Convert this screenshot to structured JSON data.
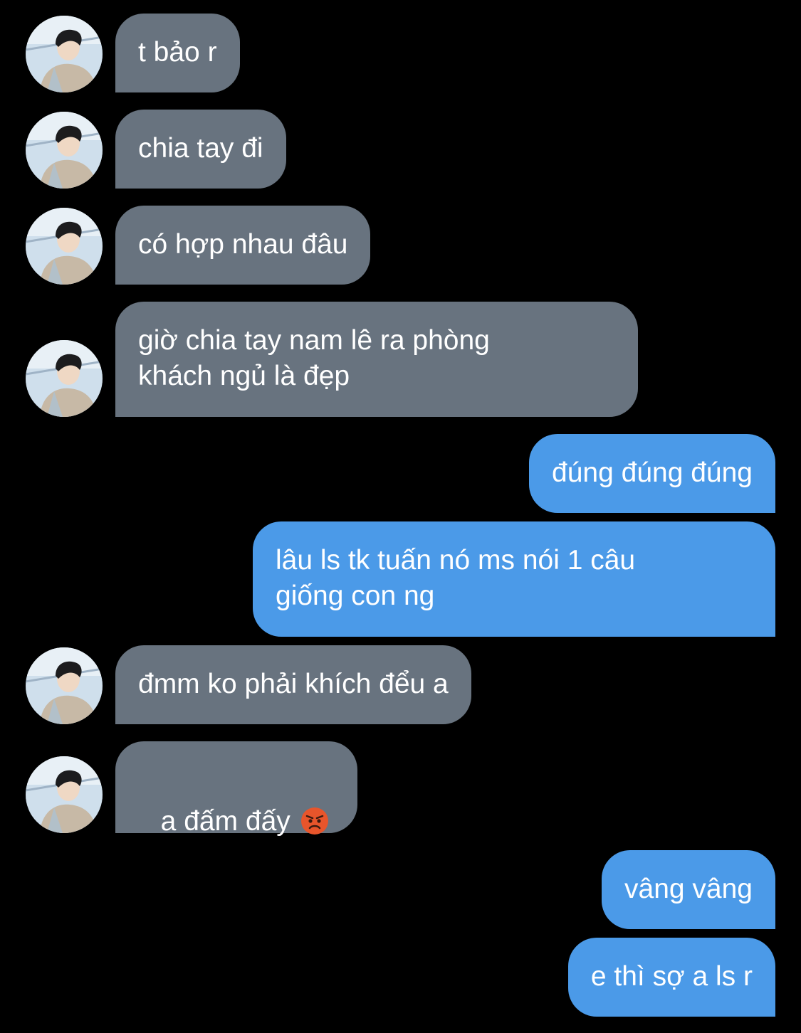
{
  "conversation": {
    "messages": [
      {
        "id": "m1",
        "side": "in",
        "text": "t bảo r"
      },
      {
        "id": "m2",
        "side": "in",
        "text": "chia tay đi"
      },
      {
        "id": "m3",
        "side": "in",
        "text": "có hợp nhau đâu"
      },
      {
        "id": "m4",
        "side": "in",
        "text": "giờ chia tay nam lê ra phòng\nkhách ngủ là đẹp"
      },
      {
        "id": "m5",
        "side": "out",
        "text": "đúng đúng đúng"
      },
      {
        "id": "m6",
        "side": "out",
        "text": "lâu ls tk tuấn nó ms nói 1 câu\ngiống con ng"
      },
      {
        "id": "m7",
        "side": "in",
        "text": "đmm ko phải khích đểu a"
      },
      {
        "id": "m8",
        "side": "in",
        "text": "a đấm đấy",
        "emoji": "angry-face-icon"
      },
      {
        "id": "m9",
        "side": "out",
        "text": "vâng vâng"
      },
      {
        "id": "m10",
        "side": "out",
        "text": "e thì sợ a ls r"
      }
    ]
  },
  "colors": {
    "background": "#000000",
    "incoming_bubble": "#68737f",
    "outgoing_bubble": "#4b9ae8",
    "text": "#ffffff"
  }
}
